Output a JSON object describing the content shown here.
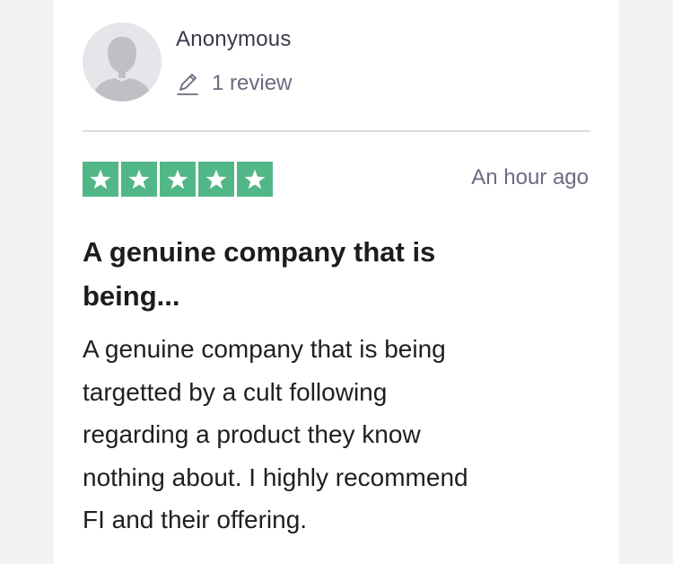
{
  "reviewer": {
    "name": "Anonymous",
    "avatar_icon": "default-person-avatar",
    "review_count_icon": "pencil-icon",
    "review_count_label": "1 review"
  },
  "review": {
    "rating": 5,
    "rating_max": 5,
    "rating_color": "#52b786",
    "timestamp": "An hour ago",
    "title_lines": [
      "A genuine company that is",
      "being..."
    ],
    "body_lines": [
      "A genuine company that is being",
      "targetted by a cult following",
      "regarding a product they know",
      "nothing about. I highly recommend",
      "FI and their offering."
    ]
  }
}
